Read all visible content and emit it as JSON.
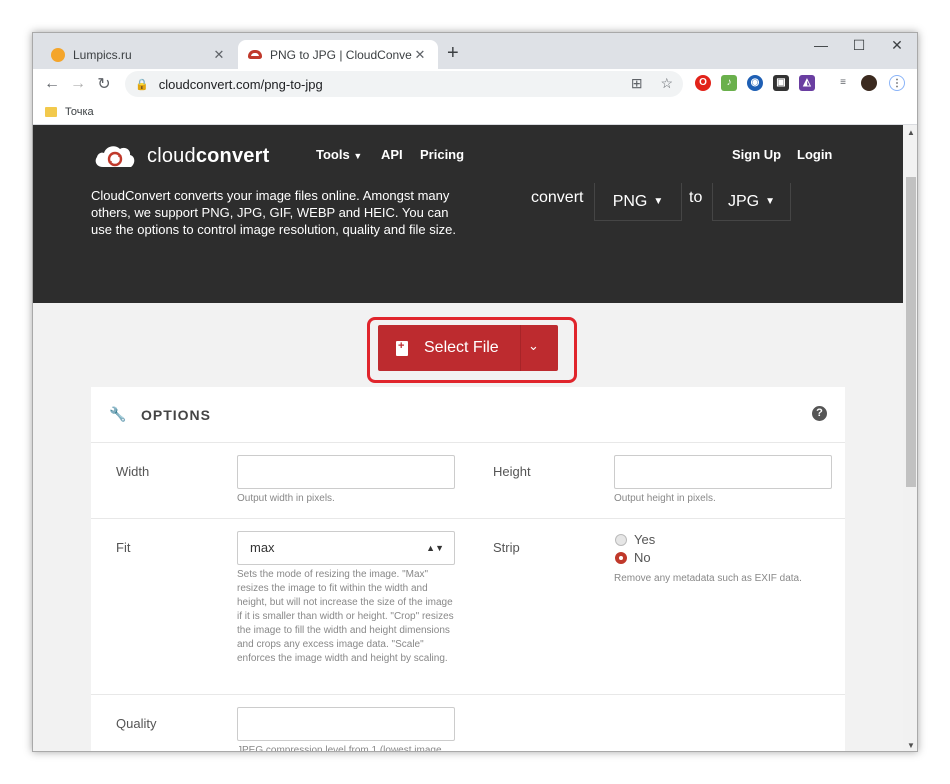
{
  "browser": {
    "tabs": [
      {
        "title": "Lumpics.ru",
        "active": false,
        "favicon_color": "#f4a52b"
      },
      {
        "title": "PNG to JPG | CloudConvert",
        "active": true,
        "favicon_color": "#c0392b"
      }
    ],
    "new_tab": "+",
    "window_controls": {
      "minimize": "—",
      "maximize": "☐",
      "close": "✕"
    },
    "nav": {
      "back": "←",
      "forward": "→",
      "reload": "↻"
    },
    "url": "cloudconvert.com/png-to-jpg",
    "bookmark_folder": "Точка"
  },
  "site": {
    "brand_light": "cloud",
    "brand_bold": "convert",
    "nav": {
      "tools": "Tools",
      "api": "API",
      "pricing": "Pricing",
      "signup": "Sign Up",
      "login": "Login"
    },
    "description": "CloudConvert converts your image files online. Amongst many others, we support PNG, JPG, GIF, WEBP and HEIC. You can use the options to control image resolution, quality and file size.",
    "convert_label": "convert",
    "from_format": "PNG",
    "to_label": "to",
    "to_format": "JPG",
    "select_file": "Select File",
    "accent_color": "#bd2b2f"
  },
  "options": {
    "title": "OPTIONS",
    "help": "?",
    "width": {
      "label": "Width",
      "value": "",
      "hint": "Output width in pixels."
    },
    "height": {
      "label": "Height",
      "value": "",
      "hint": "Output height in pixels."
    },
    "fit": {
      "label": "Fit",
      "value": "max",
      "hint": "Sets the mode of resizing the image. \"Max\" resizes the image to fit within the width and height, but will not increase the size of the image if it is smaller than width or height. \"Crop\" resizes the image to fill the width and height dimensions and crops any excess image data. \"Scale\" enforces the image width and height by scaling."
    },
    "strip": {
      "label": "Strip",
      "options": [
        "Yes",
        "No"
      ],
      "selected": "No",
      "hint": "Remove any metadata such as EXIF data."
    },
    "quality": {
      "label": "Quality",
      "value": "",
      "hint": "JPEG compression level from 1 (lowest image"
    }
  }
}
